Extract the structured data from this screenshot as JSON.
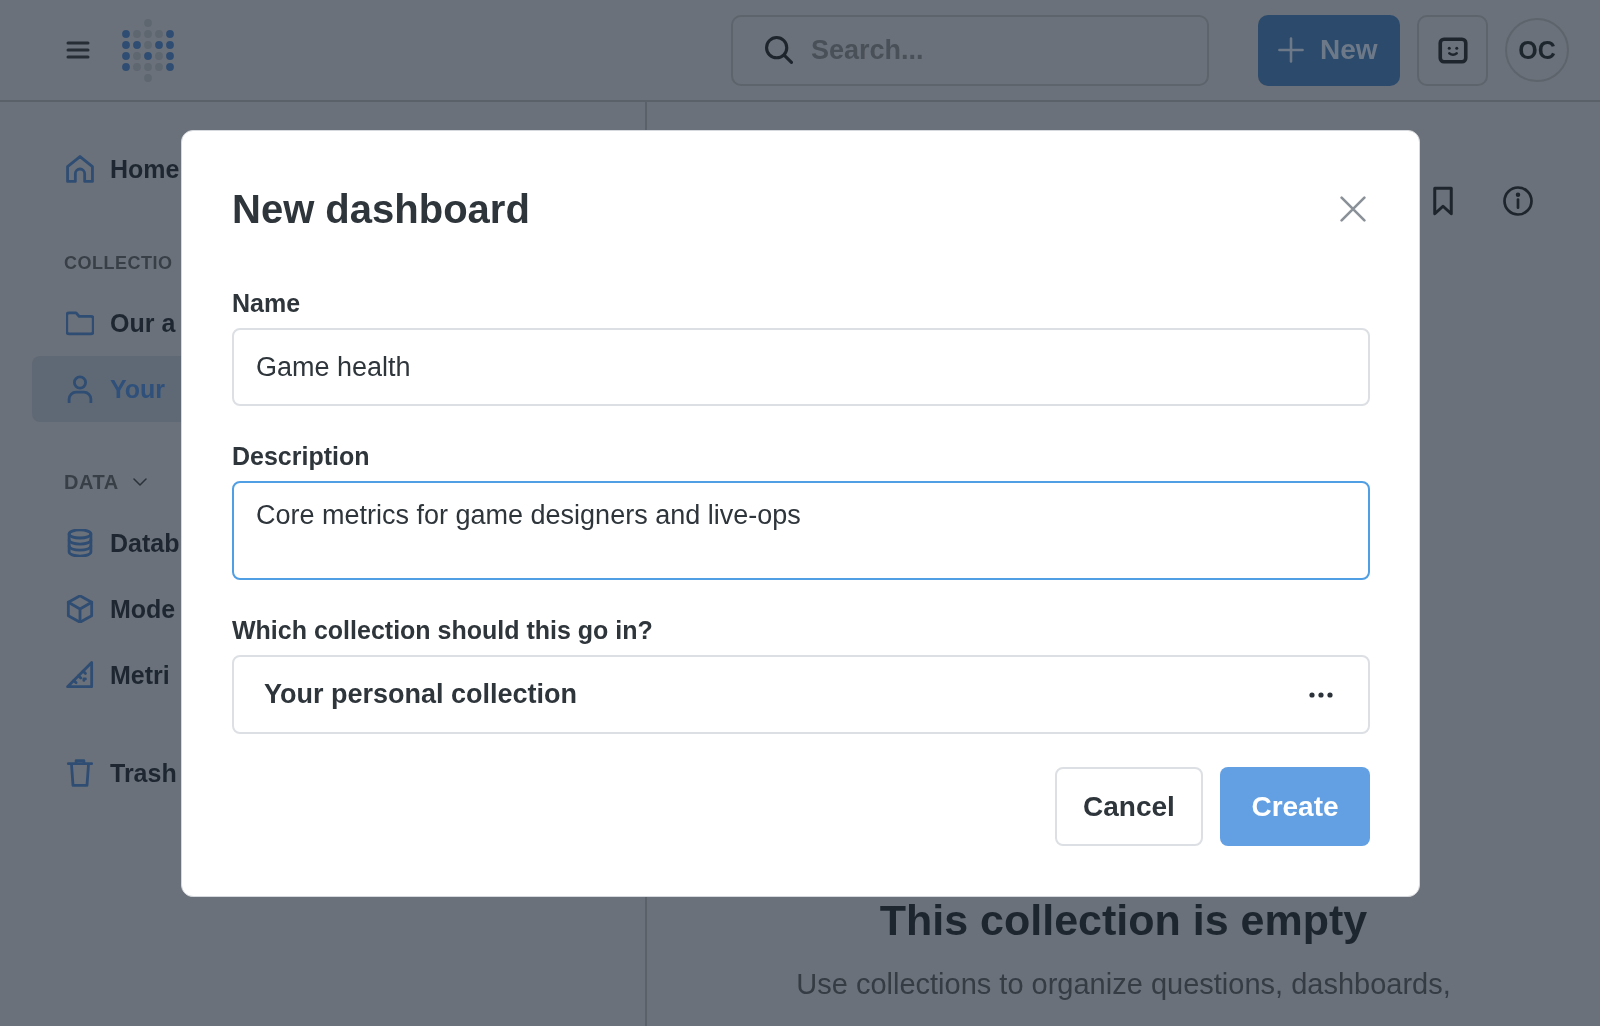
{
  "top_bar": {
    "search": {
      "placeholder": "Search..."
    },
    "new_button": {
      "label": "New"
    },
    "avatar": {
      "initials": "OC"
    }
  },
  "sidebar": {
    "home": {
      "kind": "home",
      "label": "Home",
      "selected": false
    },
    "collections": {
      "heading": "COLLECTIO",
      "items": [
        {
          "kind": "folder",
          "label": "Our a",
          "selected": false
        },
        {
          "kind": "person",
          "label": "Your",
          "selected": true
        }
      ]
    },
    "data": {
      "heading": "DATA",
      "expanded": true,
      "items": [
        {
          "kind": "database",
          "label": "Datab",
          "selected": false
        },
        {
          "kind": "cube",
          "label": "Mode",
          "selected": false
        },
        {
          "kind": "ruler",
          "label": "Metri",
          "selected": false
        }
      ]
    },
    "trash": {
      "kind": "trash",
      "label": "Trash",
      "selected": false
    }
  },
  "main": {
    "empty_state": {
      "title": "This collection is empty",
      "text": "Use collections to organize questions, dashboards,"
    }
  },
  "dialog": {
    "title": "New dashboard",
    "fields": [
      {
        "kind": "text",
        "label": "Name",
        "value": "Game health",
        "focused": false
      },
      {
        "kind": "textarea",
        "label": "Description",
        "value": "Core metrics for game designers and live-ops",
        "focused": true
      },
      {
        "kind": "picker",
        "label": "Which collection should this go in?",
        "value": "Your personal collection",
        "focused": false
      }
    ],
    "buttons": [
      {
        "kind": "secondary",
        "label": "Cancel"
      },
      {
        "kind": "primary",
        "label": "Create"
      }
    ]
  }
}
